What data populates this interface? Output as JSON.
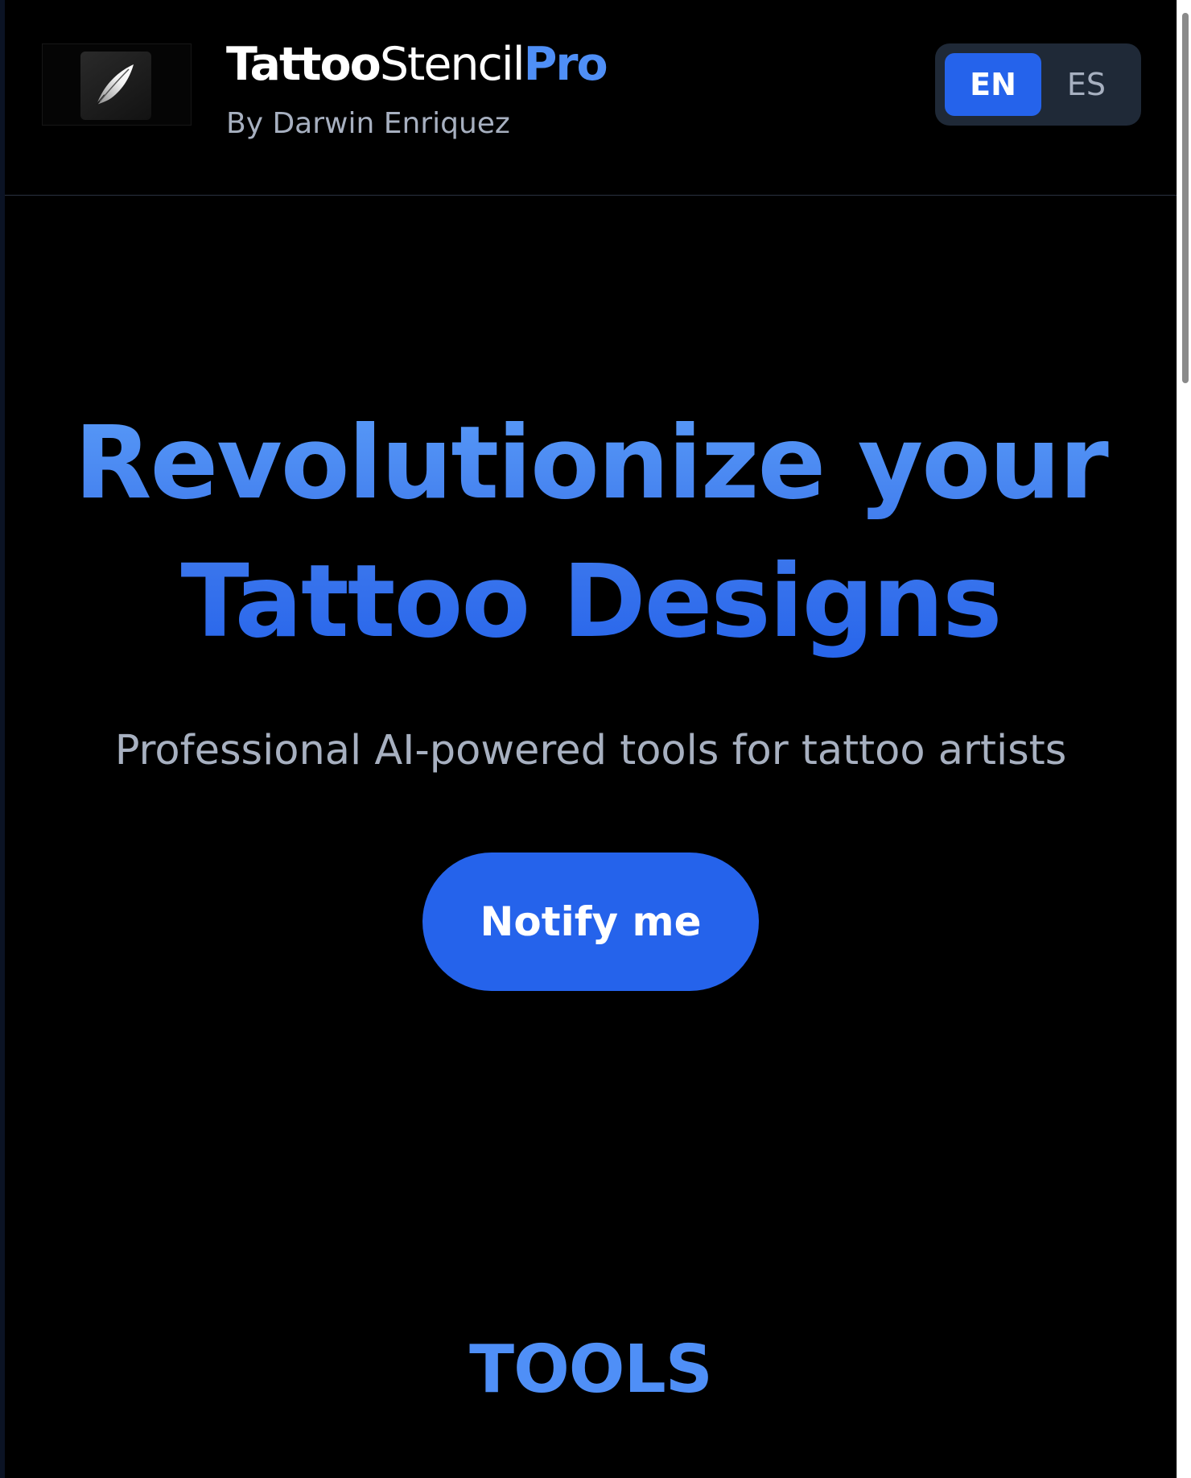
{
  "header": {
    "logo": {
      "icon": "feather-quill-icon"
    },
    "brand": {
      "part1": "Tattoo",
      "part2": "Stencil",
      "part3": "Pro"
    },
    "byline": "By Darwin Enriquez",
    "languages": [
      {
        "label": "EN",
        "active": true
      },
      {
        "label": "ES",
        "active": false
      }
    ]
  },
  "hero": {
    "title_line1": "Revolutionize your",
    "title_line2": "Tattoo Designs",
    "subtitle": "Professional AI-powered tools for tattoo artists",
    "cta_label": "Notify me"
  },
  "tools": {
    "heading": "TOOLS"
  },
  "colors": {
    "background": "#000000",
    "accent": "#2563eb",
    "accent_light": "#4f8ff7",
    "muted_text": "#a7b0c0",
    "toggle_bg": "#1f2937"
  }
}
